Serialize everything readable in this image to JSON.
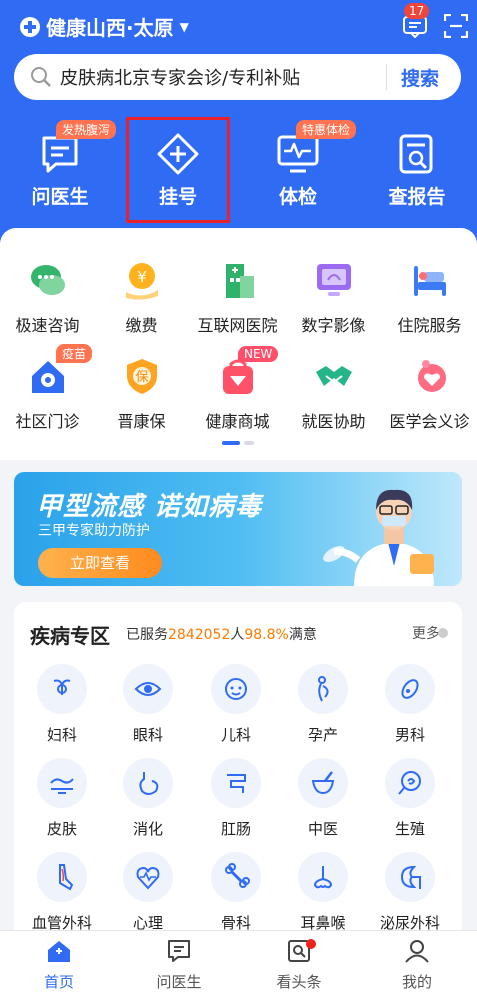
{
  "header": {
    "location": "健康山西·太原",
    "message_count": "17"
  },
  "search": {
    "placeholder": "皮肤病北京专家会诊/专利补贴",
    "button": "搜索"
  },
  "quick": [
    {
      "label": "问医生",
      "tag": "发热腹泻",
      "icon": "chat-doctor-icon"
    },
    {
      "label": "挂号",
      "tag": "",
      "icon": "register-plus-icon"
    },
    {
      "label": "体检",
      "tag": "特惠体检",
      "icon": "checkup-monitor-icon"
    },
    {
      "label": "查报告",
      "tag": "",
      "icon": "report-search-icon"
    }
  ],
  "services": [
    {
      "label": "极速咨询",
      "tag": "",
      "icon": "chat-bubbles-icon"
    },
    {
      "label": "缴费",
      "tag": "",
      "icon": "yen-coin-icon"
    },
    {
      "label": "互联网医院",
      "tag": "",
      "icon": "hospital-building-icon"
    },
    {
      "label": "数字影像",
      "tag": "",
      "icon": "monitor-image-icon"
    },
    {
      "label": "住院服务",
      "tag": "",
      "icon": "hospital-bed-icon"
    },
    {
      "label": "社区门诊",
      "tag": "疫苗",
      "icon": "home-clinic-icon"
    },
    {
      "label": "晋康保",
      "tag": "",
      "icon": "shield-bao-icon"
    },
    {
      "label": "健康商城",
      "tag": "NEW",
      "icon": "shop-bag-icon"
    },
    {
      "label": "就医协助",
      "tag": "",
      "icon": "handshake-icon"
    },
    {
      "label": "医学会义诊",
      "tag": "",
      "icon": "heart-hand-icon"
    }
  ],
  "banner": {
    "title": "甲型流感 诺如病毒",
    "subtitle": "三甲专家助力防护",
    "cta": "立即查看"
  },
  "departments": {
    "title": "疾病专区",
    "served_prefix": "已服务",
    "served_count": "2842052",
    "served_suffix": "人",
    "satisfaction": "98.8%",
    "satisfaction_suffix": "满意",
    "more": "更多",
    "items": [
      {
        "label": "妇科",
        "icon": "uterus-icon"
      },
      {
        "label": "眼科",
        "icon": "eye-icon"
      },
      {
        "label": "儿科",
        "icon": "baby-face-icon"
      },
      {
        "label": "孕产",
        "icon": "pregnant-icon"
      },
      {
        "label": "男科",
        "icon": "male-icon"
      },
      {
        "label": "皮肤",
        "icon": "skin-icon"
      },
      {
        "label": "消化",
        "icon": "stomach-icon"
      },
      {
        "label": "肛肠",
        "icon": "intestine-icon"
      },
      {
        "label": "中医",
        "icon": "mortar-icon"
      },
      {
        "label": "生殖",
        "icon": "embryo-icon"
      },
      {
        "label": "血管外科",
        "icon": "leg-vessel-icon"
      },
      {
        "label": "心理",
        "icon": "heart-pulse-icon"
      },
      {
        "label": "骨科",
        "icon": "bone-icon"
      },
      {
        "label": "耳鼻喉",
        "icon": "nose-icon"
      },
      {
        "label": "泌尿外科",
        "icon": "kidney-icon"
      }
    ]
  },
  "tabbar": [
    {
      "label": "首页",
      "icon": "home-icon",
      "active": true
    },
    {
      "label": "问医生",
      "icon": "chat-doctor-icon",
      "active": false
    },
    {
      "label": "看头条",
      "icon": "news-icon",
      "active": false
    },
    {
      "label": "我的",
      "icon": "profile-icon",
      "active": false
    }
  ],
  "colors": {
    "primary": "#2f6bf3",
    "accent": "#ff7a00",
    "highlight": "#e8212c"
  }
}
